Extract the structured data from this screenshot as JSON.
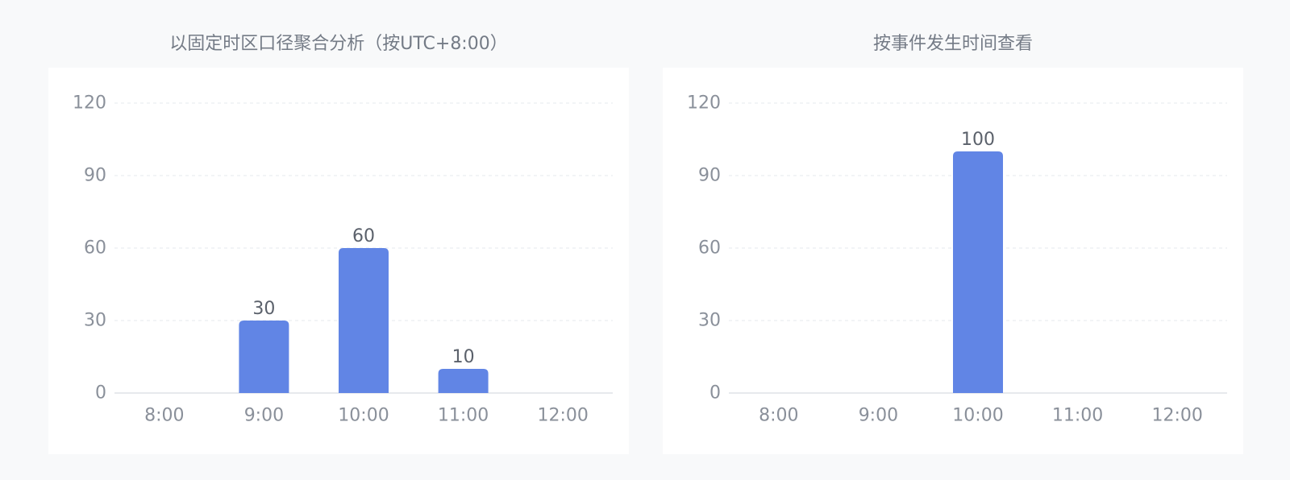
{
  "accent_color": "#6185e5",
  "chart_data": [
    {
      "type": "bar",
      "title": "以固定时区口径聚合分析（按UTC+8:00）",
      "xlabel": "",
      "ylabel": "",
      "categories": [
        "8:00",
        "9:00",
        "10:00",
        "11:00",
        "12:00"
      ],
      "values": [
        0,
        30,
        60,
        10,
        0
      ],
      "data_labels": [
        "",
        "30",
        "60",
        "10",
        ""
      ],
      "ylim": [
        0,
        120
      ],
      "yticks": [
        0,
        30,
        60,
        90,
        120
      ],
      "ytick_labels": [
        "0",
        "30",
        "60",
        "90",
        "120"
      ],
      "grid": true,
      "color": "#6185e5"
    },
    {
      "type": "bar",
      "title": "按事件发生时间查看",
      "xlabel": "",
      "ylabel": "",
      "categories": [
        "8:00",
        "9:00",
        "10:00",
        "11:00",
        "12:00"
      ],
      "values": [
        0,
        0,
        100,
        0,
        0
      ],
      "data_labels": [
        "",
        "",
        "100",
        "",
        ""
      ],
      "ylim": [
        0,
        120
      ],
      "yticks": [
        0,
        30,
        60,
        90,
        120
      ],
      "ytick_labels": [
        "0",
        "30",
        "60",
        "90",
        "120"
      ],
      "grid": true,
      "color": "#6185e5"
    }
  ]
}
